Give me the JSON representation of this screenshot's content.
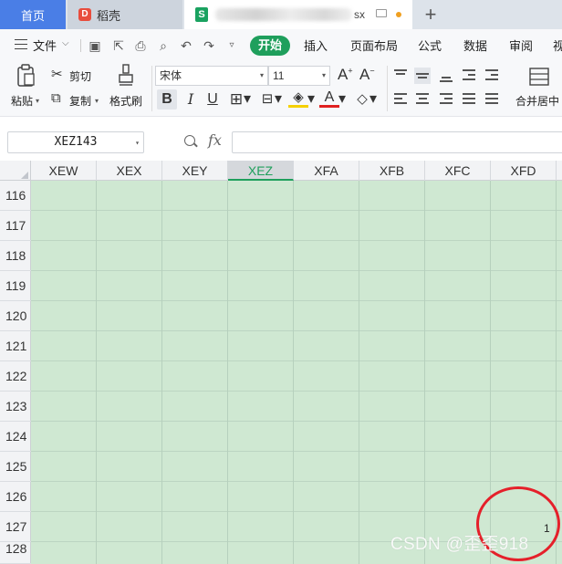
{
  "tabs": {
    "home": "首页",
    "docer": "稻壳",
    "file_ext": "sx",
    "new_tab": "+"
  },
  "menu": {
    "file": "文件",
    "start": "开始",
    "insert": "插入",
    "page_layout": "页面布局",
    "formula": "公式",
    "data": "数据",
    "review": "审阅",
    "view": "视"
  },
  "ribbon": {
    "paste": "粘贴",
    "cut": "剪切",
    "copy": "复制",
    "format_painter": "格式刷",
    "font_name": "宋体",
    "font_size": "11",
    "merge_center": "合并居中",
    "bold": "B",
    "italic": "I",
    "underline": "U",
    "font_color_glyph": "A"
  },
  "formula_bar": {
    "name_box": "XEZ143",
    "fx": "fx",
    "formula": ""
  },
  "grid": {
    "columns": [
      "XEW",
      "XEX",
      "XEY",
      "XEZ",
      "XFA",
      "XFB",
      "XFC",
      "XFD"
    ],
    "active_column": "XEZ",
    "rows": [
      "116",
      "117",
      "118",
      "119",
      "120",
      "121",
      "122",
      "123",
      "124",
      "125",
      "126",
      "127",
      "128"
    ],
    "cell_value": "1"
  },
  "watermark": "CSDN @歪歪918",
  "colors": {
    "accent_green": "#1f9f5c",
    "home_tab_blue": "#4a7ee6",
    "cell_fill": "#cfe8d2",
    "annotation_red": "#e5202a"
  }
}
